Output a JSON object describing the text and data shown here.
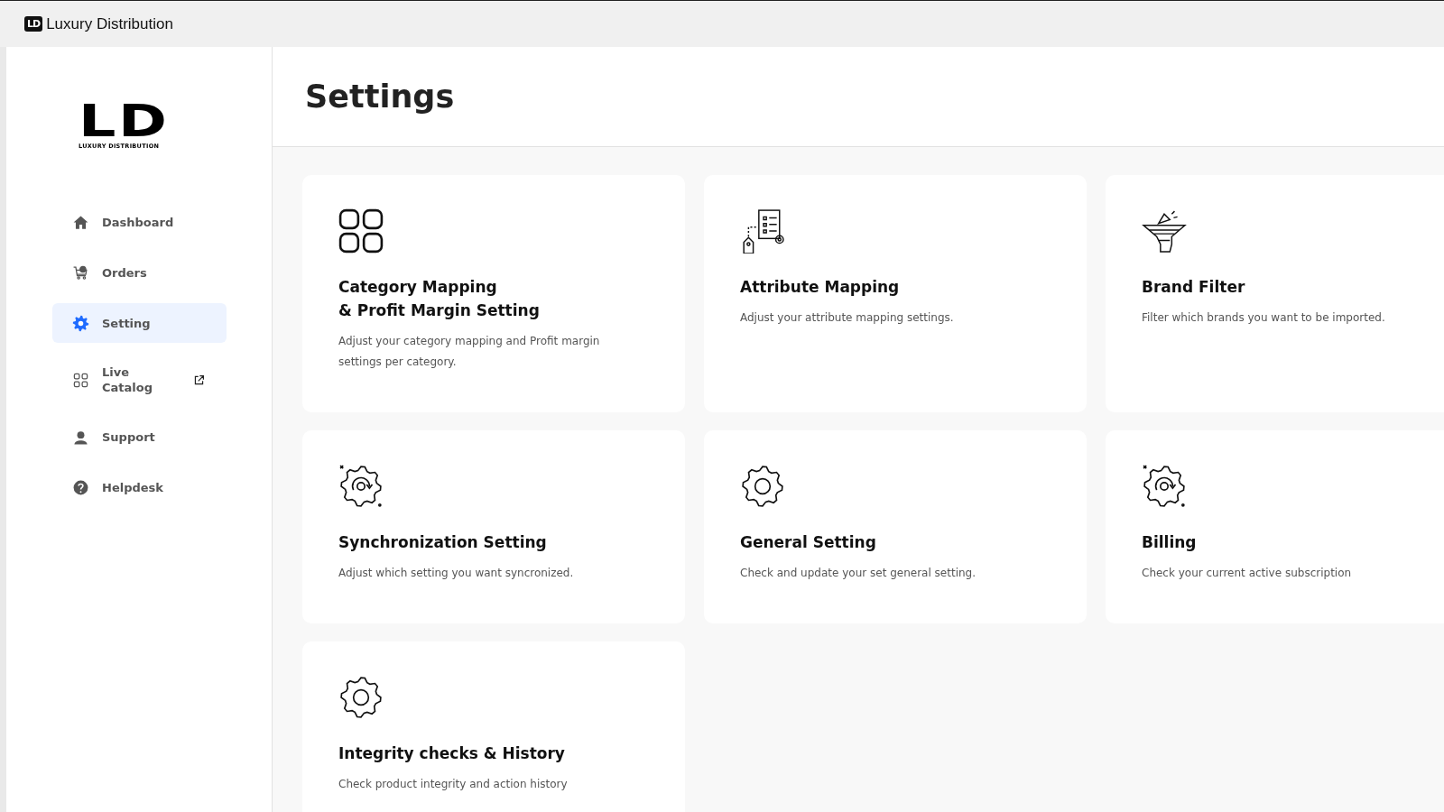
{
  "topbar": {
    "logo_mark": "LD",
    "title": "Luxury Distribution"
  },
  "logo": {
    "mark": "LD",
    "tagline": "LUXURY DISTRIBUTION"
  },
  "sidebar": {
    "items": [
      {
        "label": "Dashboard",
        "kind": "home",
        "selected": false,
        "external": false
      },
      {
        "label": "Orders",
        "kind": "cart",
        "selected": false,
        "external": false
      },
      {
        "label": "Setting",
        "kind": "gear",
        "selected": true,
        "external": false
      },
      {
        "label": "Live Catalog",
        "kind": "grid",
        "selected": false,
        "external": true
      },
      {
        "label": "Support",
        "kind": "support",
        "selected": false,
        "external": false
      },
      {
        "label": "Helpdesk",
        "kind": "help",
        "selected": false,
        "external": false
      }
    ]
  },
  "page": {
    "title": "Settings"
  },
  "cards": [
    {
      "kind": "grid",
      "title": "Category Mapping\n& Profit Margin Setting",
      "description": "Adjust your category mapping and Profit margin settings per category."
    },
    {
      "kind": "attribute",
      "title": "Attribute Mapping",
      "description": "Adjust your attribute mapping settings."
    },
    {
      "kind": "funnel",
      "title": "Brand Filter",
      "description": "Filter which brands you want to be imported."
    },
    {
      "kind": "sync",
      "title": "Synchronization Setting",
      "description": "Adjust which setting you want syncronized."
    },
    {
      "kind": "gear",
      "title": "General Setting",
      "description": "Check and update your set general setting."
    },
    {
      "kind": "sync",
      "title": "Billing",
      "description": "Check your current active subscription"
    },
    {
      "kind": "gear",
      "title": "Integrity checks & History",
      "description": "Check product integrity and action history"
    }
  ]
}
